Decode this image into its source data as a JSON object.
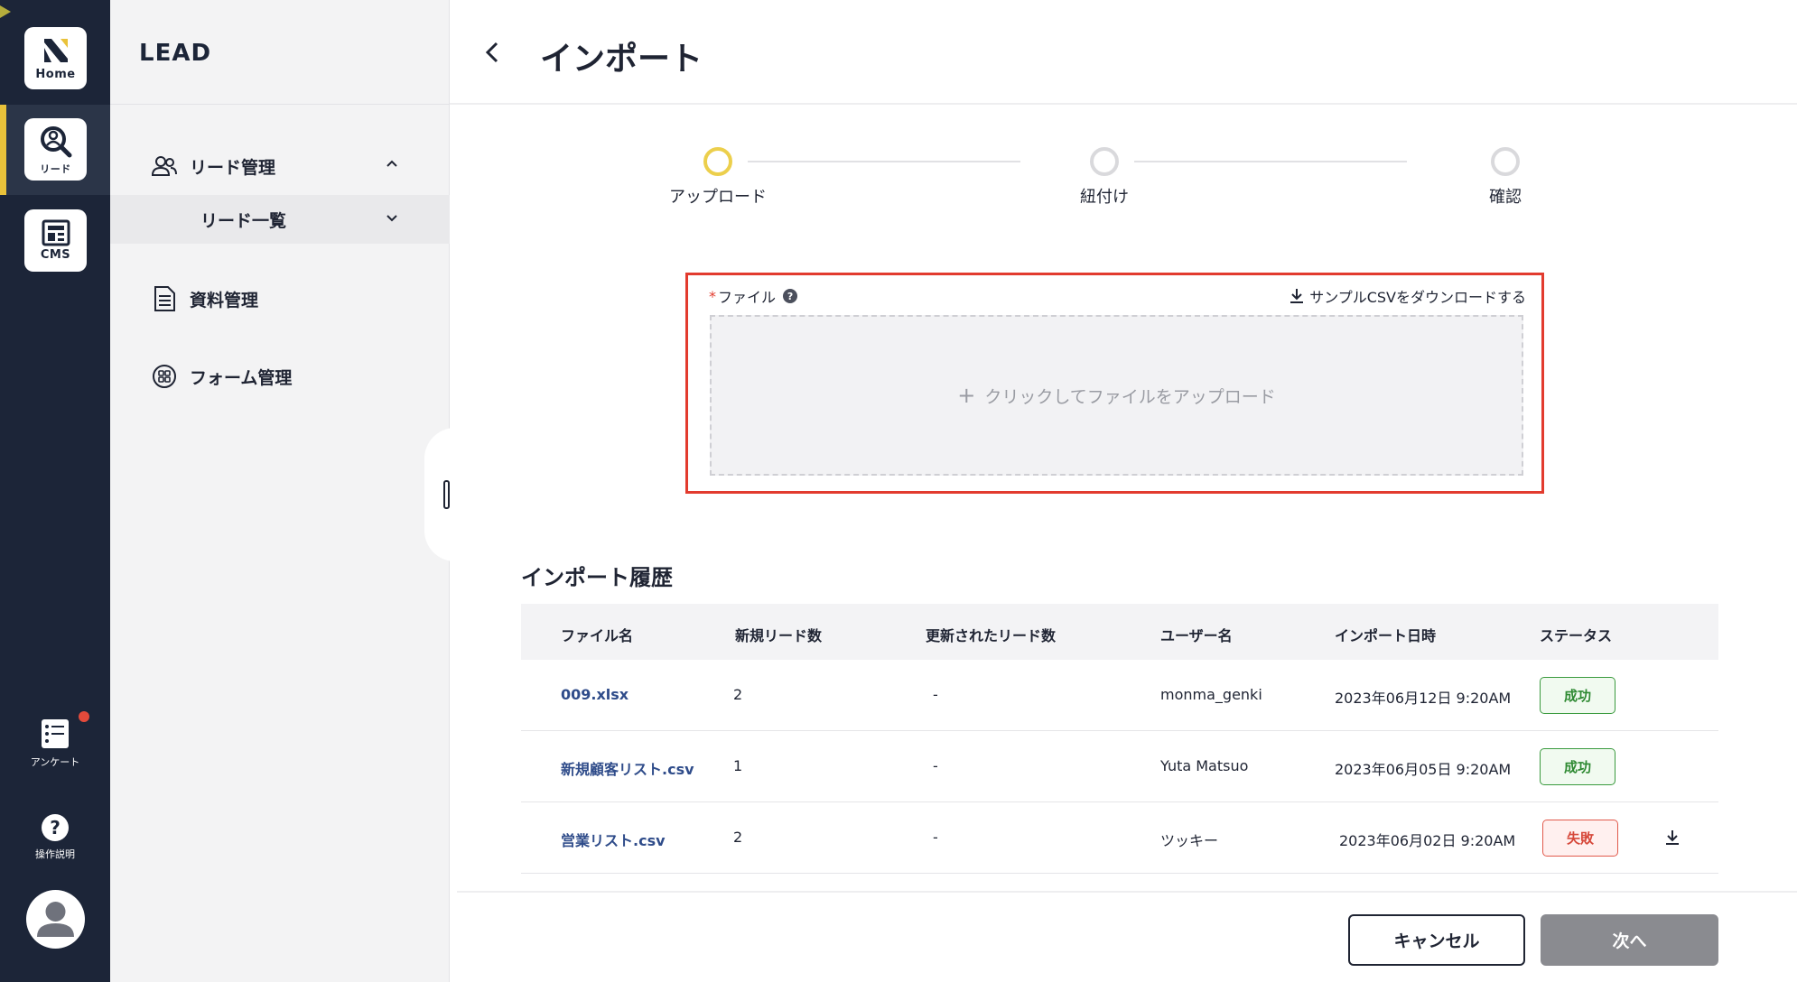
{
  "rail": {
    "home_label": "Home",
    "lead_label": "リード",
    "cms_label": "CMS",
    "survey_label": "アンケート",
    "help_label": "操作説明"
  },
  "sidebar": {
    "brand": "LEAD",
    "items": [
      {
        "label": "リード管理"
      },
      {
        "label": "リード一覧"
      },
      {
        "label": "資料管理"
      },
      {
        "label": "フォーム管理"
      }
    ]
  },
  "header": {
    "title": "インポート"
  },
  "stepper": {
    "steps": [
      {
        "label": "アップロード",
        "state": "active"
      },
      {
        "label": "紐付け",
        "state": "pending"
      },
      {
        "label": "確認",
        "state": "pending"
      }
    ]
  },
  "upload": {
    "required_mark": "*",
    "label": "ファイル",
    "help_mark": "?",
    "sample_link": "サンプルCSVをダウンロードする",
    "dropzone_plus": "+",
    "dropzone_text": "クリックしてファイルをアップロード"
  },
  "history": {
    "title": "インポート履歴",
    "columns": [
      "ファイル名",
      "新規リード数",
      "更新されたリード数",
      "ユーザー名",
      "インポート日時",
      "ステータス"
    ],
    "rows": [
      {
        "file": "009.xlsx",
        "new": "2",
        "updated": "-",
        "user": "monma_genki",
        "date": "2023年06月12日 9:20AM",
        "status": "成功",
        "status_type": "ok"
      },
      {
        "file": "新規顧客リスト.csv",
        "new": "1",
        "updated": "-",
        "user": "Yuta Matsuo",
        "date": "2023年06月05日 9:20AM",
        "status": "成功",
        "status_type": "ok"
      },
      {
        "file": "営業リスト.csv",
        "new": "2",
        "updated": "-",
        "user": "ツッキー",
        "date": "2023年06月02日 9:20AM",
        "status": "失敗",
        "status_type": "ng"
      }
    ]
  },
  "footer": {
    "cancel_label": "キャンセル",
    "next_label": "次へ"
  },
  "colors": {
    "rail_bg": "#1c2538",
    "accent_yellow": "#eccf4c",
    "highlight_red": "#e23b2e",
    "link_blue": "#2f4c8a",
    "success_green": "#2f8a33",
    "fail_red": "#d6483a"
  }
}
